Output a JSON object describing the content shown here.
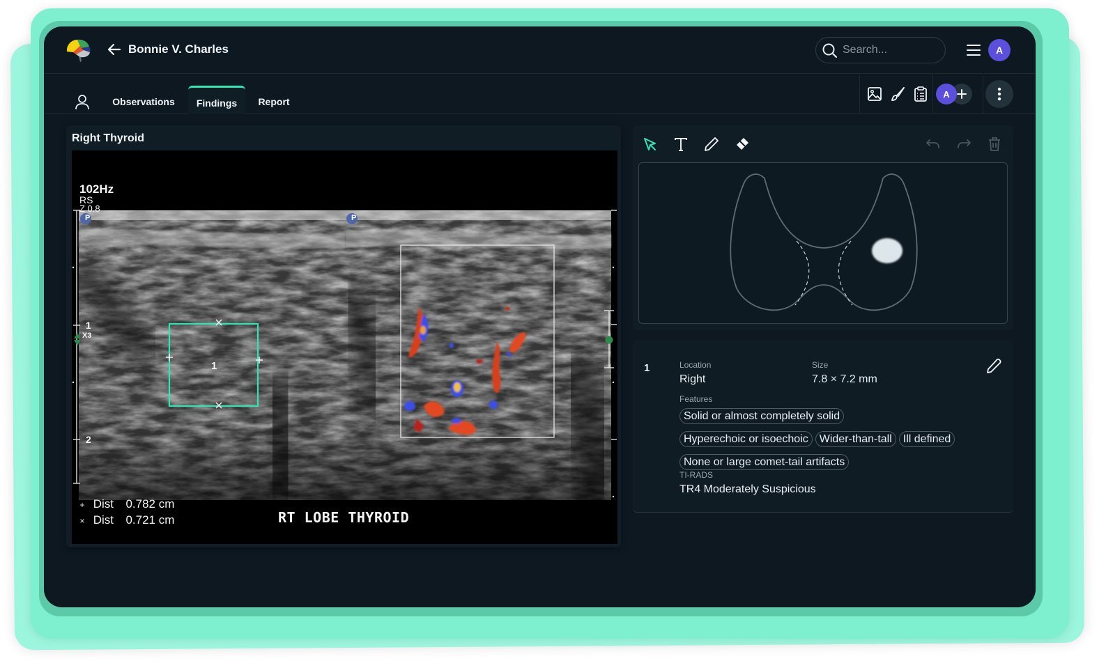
{
  "header": {
    "patient_name": "Bonnie V. Charles",
    "search_placeholder": "Search...",
    "user_initial": "A"
  },
  "tabs": [
    {
      "label": "Observations",
      "active": false
    },
    {
      "label": "Findings",
      "active": true
    },
    {
      "label": "Report",
      "active": false
    }
  ],
  "toolbar": {
    "icons": [
      "image-icon",
      "brush-icon",
      "clipboard-list-icon"
    ],
    "collaborator_initial": "A",
    "add_collaborator": "+"
  },
  "image_panel": {
    "title": "Right Thyroid",
    "overlay": {
      "frequency": "102Hz",
      "mode": "RS",
      "zoom": "Z 0.8",
      "depth_marks": [
        "1",
        "2"
      ],
      "focus_label": "X3",
      "caliper_label": "1",
      "measurements": [
        {
          "symbol": "+",
          "label": "Dist",
          "value": "0.782 cm"
        },
        {
          "symbol": "×",
          "label": "Dist",
          "value": "0.721 cm"
        }
      ],
      "annotation": "RT LOBE THYROID",
      "probe_marker": "P"
    }
  },
  "drawing": {
    "tools": [
      {
        "name": "select-arrow",
        "active": true
      },
      {
        "name": "text",
        "active": false
      },
      {
        "name": "pencil",
        "active": false
      },
      {
        "name": "eraser",
        "active": false
      }
    ],
    "history": [
      "undo",
      "redo",
      "delete"
    ]
  },
  "finding": {
    "number": "1",
    "location_label": "Location",
    "location": "Right",
    "size_label": "Size",
    "size": "7.8 × 7.2 mm",
    "features_label": "Features",
    "features": [
      "Solid or almost completely solid",
      "Hyperechoic or isoechoic",
      "Wider-than-tall",
      "Ill defined",
      "None or large comet-tail artifacts"
    ],
    "tirads_label": "TI-RADS",
    "tirads": "TR4 Moderately Suspicious"
  },
  "colors": {
    "accent": "#2ee6b0",
    "background": "#0d1820",
    "avatar": "#5b4fdc",
    "frame": "#7ef0cf"
  }
}
